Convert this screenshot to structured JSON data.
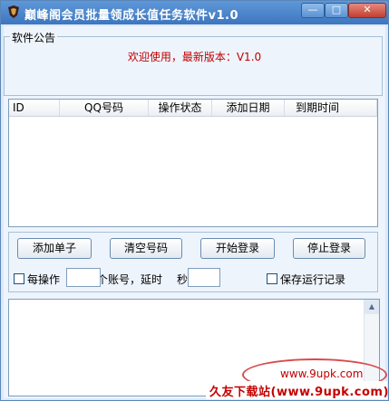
{
  "window": {
    "title": "巅峰阁会员批量领成长值任务软件v1.0",
    "minimize_glyph": "—",
    "maximize_glyph": "□",
    "close_glyph": "✕"
  },
  "announcement": {
    "group_label": "软件公告",
    "message": "欢迎使用，最新版本：V1.0"
  },
  "table": {
    "columns": [
      "ID",
      "QQ号码",
      "操作状态",
      "添加日期",
      "到期时间"
    ]
  },
  "buttons": {
    "add": "添加单子",
    "clear": "清空号码",
    "start": "开始登录",
    "stop": "停止登录"
  },
  "options": {
    "per_operation_label": "每操作",
    "accounts_delay_label": "个账号，延时",
    "seconds_label": "秒",
    "save_log_label": "保存运行记录",
    "per_operation_value": "",
    "delay_value": ""
  },
  "watermark": {
    "url": "www.9upk.com",
    "site": "久友下载站(www.9upk.com)"
  },
  "colors": {
    "title_bar": "#3d76bf",
    "announcement_text": "#c00000",
    "watermark": "#c40000"
  }
}
